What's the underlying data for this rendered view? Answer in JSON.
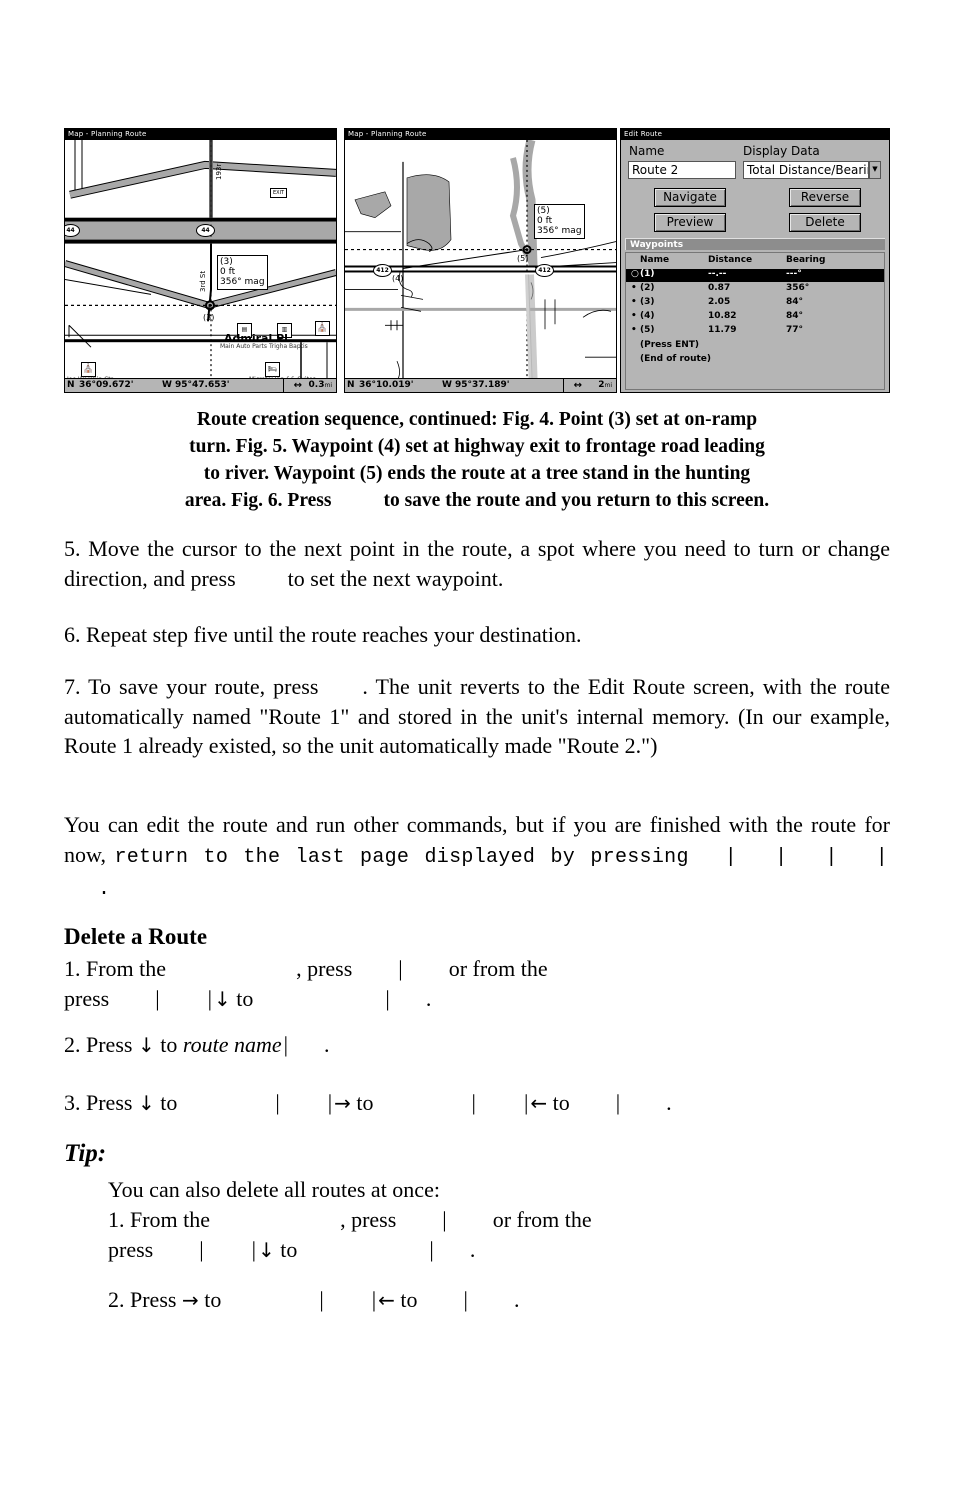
{
  "figures": {
    "fig4": {
      "title": "Map - Planning Route",
      "callout": {
        "name": "(3)",
        "elevation": "0 ft",
        "bearing": "356° mag"
      },
      "waypoint_marker": "(3)",
      "street_label": "3rd St",
      "ramp_label": "193r",
      "exit_badge": "EXIT",
      "shield_left": "44",
      "shield_center": "44",
      "place_label": "Admiral Pl.",
      "poi_row": "Main Auto Parts    Trigha Baptis",
      "poi_left": "Joe Worship Ctr",
      "poi_right": "Microtel Inn && Suites",
      "status": {
        "lat_hemisphere": "N",
        "latitude": "36°09.672'",
        "lon_hemisphere": "W",
        "longitude": "95°47.653'",
        "scale_value": "0.3",
        "scale_unit": "mi"
      }
    },
    "fig5": {
      "title": "Map - Planning Route",
      "callout": {
        "name": "(5)",
        "elevation": "0 ft",
        "bearing": "356° mag"
      },
      "waypoint_4": "(4)",
      "waypoint_5": "(5)",
      "shield_left": "412",
      "shield_right": "412",
      "status": {
        "lat_hemisphere": "N",
        "latitude": "36°10.019'",
        "lon_hemisphere": "W",
        "longitude": "95°37.189'",
        "scale_value": "2",
        "scale_unit": "mi"
      }
    },
    "fig6": {
      "title": "Edit Route",
      "name_label": "Name",
      "name_value": "Route 2",
      "display_data_label": "Display Data",
      "display_data_value": "Total Distance/Bearing",
      "buttons": {
        "navigate": "Navigate",
        "reverse": "Reverse",
        "preview": "Preview",
        "delete": "Delete"
      },
      "waypoints_section": "Waypoints",
      "columns": [
        "Name",
        "Distance",
        "Bearing"
      ],
      "rows": [
        {
          "bullet": "○",
          "name": "(1)",
          "distance": "--.--",
          "bearing": "---°",
          "selected": true
        },
        {
          "bullet": "•",
          "name": "(2)",
          "distance": "0.87",
          "bearing": "356°",
          "selected": false
        },
        {
          "bullet": "•",
          "name": "(3)",
          "distance": "2.05",
          "bearing": "84°",
          "selected": false
        },
        {
          "bullet": "•",
          "name": "(4)",
          "distance": "10.82",
          "bearing": "84°",
          "selected": false
        },
        {
          "bullet": "•",
          "name": "(5)",
          "distance": "11.79",
          "bearing": "77°",
          "selected": false
        }
      ],
      "notes": [
        "(Press ENT)",
        "(End of route)"
      ]
    }
  },
  "caption": {
    "line1": "Route creation sequence, continued: Fig. 4. Point (3) set at on-ramp",
    "line2": "turn. Fig. 5. Waypoint (4) set at highway exit to frontage road leading",
    "line3": "to river. Waypoint (5) ends the route at a tree stand in the hunting",
    "line4_a": "area. Fig. 6. Press",
    "line4_b": "to save the route and you return to this screen."
  },
  "body": {
    "step5_a": "5. Move the cursor to the next point in the route, a spot where you need to turn or change direction, and press",
    "step5_b": "to set the next waypoint.",
    "step6": "6. Repeat step five until the route reaches your destination.",
    "step7_a": "7. To save your route, press",
    "step7_b": ". The unit reverts to the Edit Route screen, with the route automatically named \"Route 1\" and stored in the unit's internal memory. (In our example, Route 1 already existed, so the unit automatically made \"Route 2.\")",
    "para_edit_a": "You can edit the route and run other commands, but if you are finished with the route for now,",
    "para_edit_mono": "return to the last page displayed by pressing",
    "para_edit_bars": [
      "|",
      "|",
      "|",
      "|"
    ],
    "para_edit_end": "."
  },
  "delete_route": {
    "heading": "Delete a Route",
    "step1_a": "1. From the",
    "step1_b": ", press",
    "step1_bar": "|",
    "step1_c": "or from the",
    "step1_d": "press",
    "step1_bar2": "|",
    "step1_bar3": "|",
    "step1_arrow": "↓",
    "step1_e": "to",
    "step1_bar4": "|",
    "step1_end": ".",
    "step2_a": "2. Press",
    "step2_arrow": "↓",
    "step2_b": "to",
    "step2_italic": "route name",
    "step2_bar": "|",
    "step2_end": ".",
    "step3_a": "3. Press",
    "step3_arrow1": "↓",
    "step3_b": "to",
    "step3_bar1": "|",
    "step3_bar2": "|",
    "step3_arrow2": "→",
    "step3_c": "to",
    "step3_bar3": "|",
    "step3_bar4": "|",
    "step3_arrow3": "←",
    "step3_d": "to",
    "step3_bar5": "|",
    "step3_end": "."
  },
  "tip": {
    "heading": "Tip:",
    "intro": "You can also delete all routes at once:",
    "step1_a": "1. From the",
    "step1_b": ", press",
    "step1_bar": "|",
    "step1_c": "or from the",
    "step1_d": "press",
    "step1_bar2": "|",
    "step1_bar3": "|",
    "step1_arrow": "↓",
    "step1_e": "to",
    "step1_bar4": "|",
    "step1_end": ".",
    "step2_a": "2. Press",
    "step2_arrow1": "→",
    "step2_b": "to",
    "step2_bar1": "|",
    "step2_bar2": "|",
    "step2_arrow2": "←",
    "step2_c": "to",
    "step2_bar3": "|",
    "step2_end": "."
  },
  "colors": {
    "lcd_gray": "#b5b5b5",
    "road_gray": "#a8a8a8",
    "water_gray": "#9c9c9c",
    "section_gray": "#8d8d8d",
    "ink": "#000000"
  }
}
